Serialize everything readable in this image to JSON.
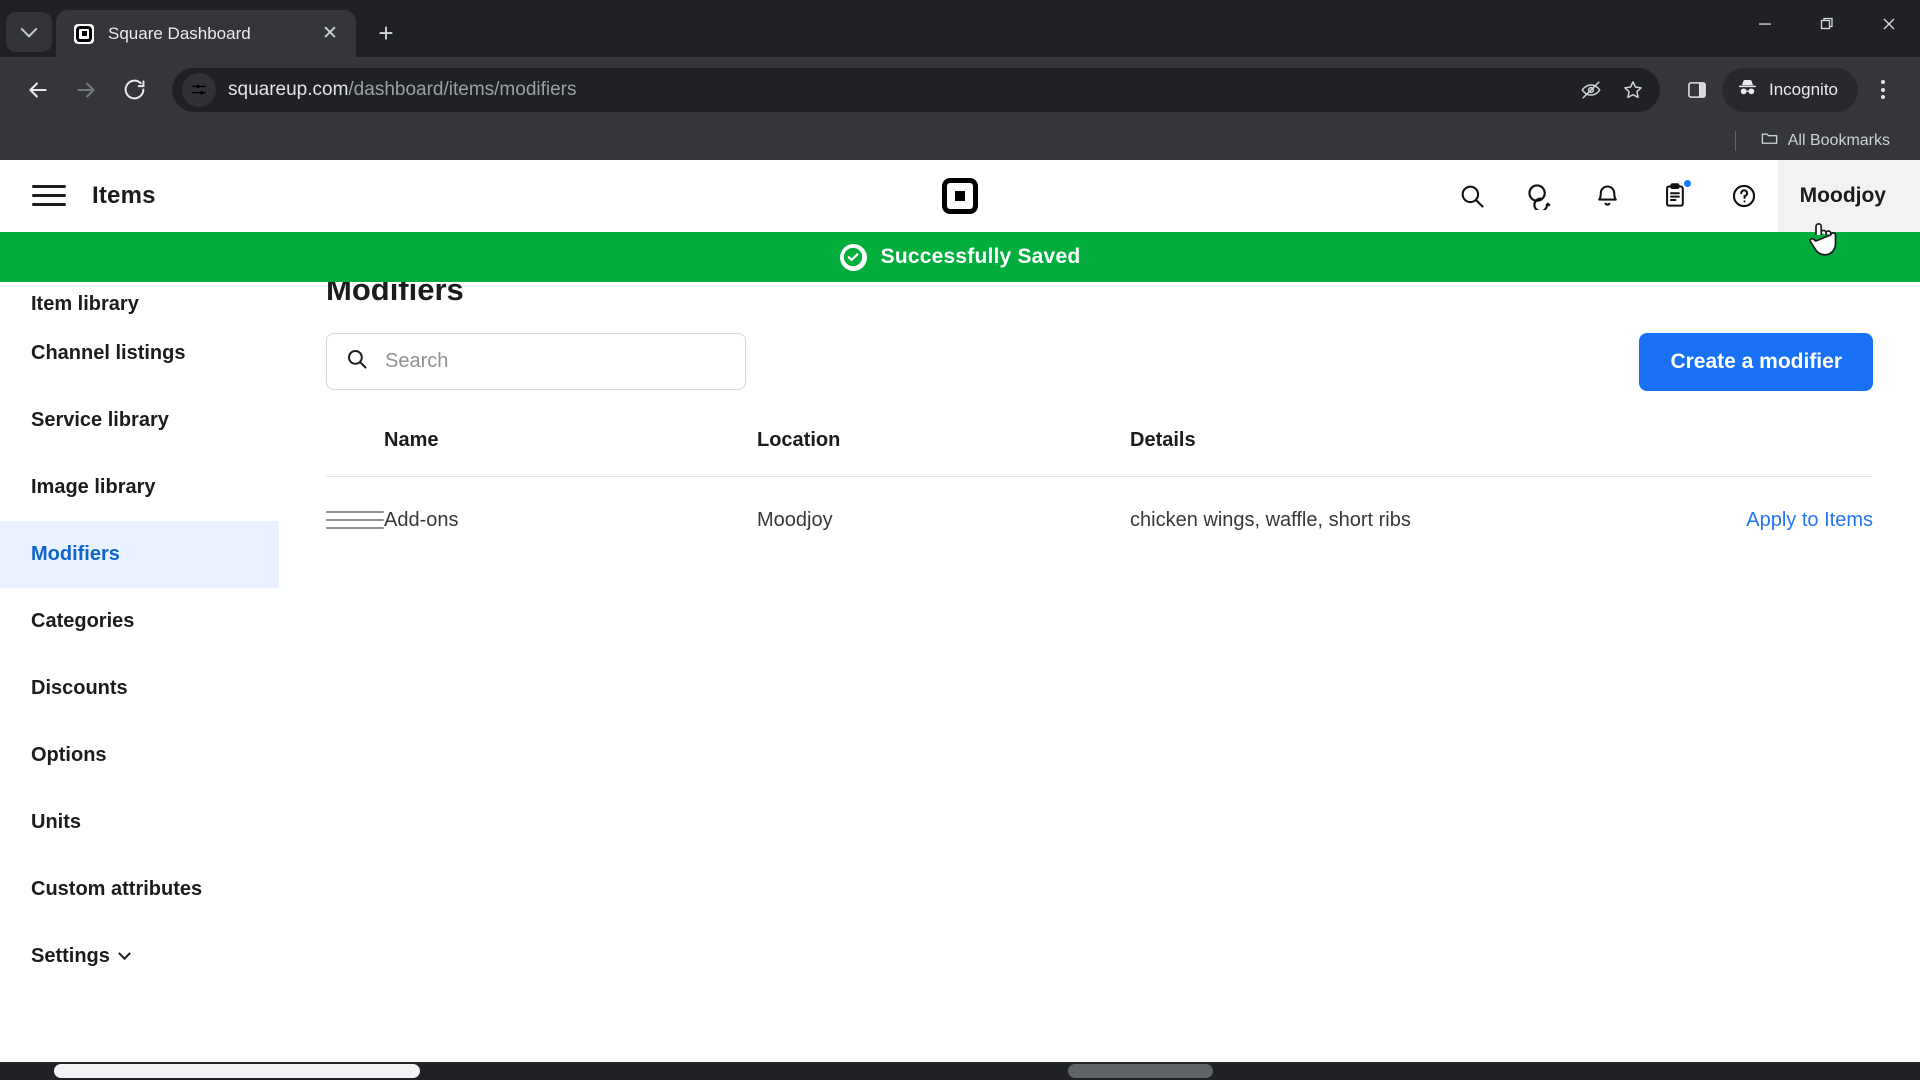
{
  "browser": {
    "tab": {
      "title": "Square Dashboard",
      "favicon_icon": "square-logo-icon",
      "close_icon": "close-icon"
    },
    "tab_search_icon": "chevron-down-icon",
    "new_tab_icon": "plus-icon",
    "window_controls": {
      "minimize_icon": "minimize-icon",
      "maximize_icon": "restore-icon",
      "close_icon": "close-icon"
    },
    "toolbar": {
      "back_icon": "back-arrow-icon",
      "forward_icon": "forward-arrow-icon",
      "reload_icon": "reload-icon",
      "site_info_icon": "page-settings-icon",
      "url_prefix": "squareup.com",
      "url_path": "/dashboard/items/modifiers",
      "url_full": "squareup.com/dashboard/items/modifiers",
      "tracking_protection_icon": "eye-slash-icon",
      "bookmark_icon": "star-icon",
      "side_panel_icon": "side-panel-icon",
      "incognito_label": "Incognito",
      "incognito_icon": "incognito-hat-icon",
      "menu_icon": "kebab-menu-icon"
    },
    "bookmarks_bar": {
      "all_bookmarks_label": "All Bookmarks",
      "folder_icon": "folder-icon"
    }
  },
  "app": {
    "header": {
      "menu_icon": "hamburger-menu-icon",
      "title": "Items",
      "logo_icon": "square-logo-icon",
      "icons": [
        {
          "name": "search-icon"
        },
        {
          "name": "messages-icon"
        },
        {
          "name": "notifications-bell-icon"
        },
        {
          "name": "clipboard-tasks-icon",
          "badge": true
        },
        {
          "name": "help-circle-icon"
        }
      ],
      "account_label": "Moodjoy"
    },
    "banner": {
      "text": "Successfully Saved",
      "icon": "check-circle-icon",
      "color": "#00ad3d"
    },
    "sidebar": {
      "items": [
        {
          "label": "Item library",
          "active": false
        },
        {
          "label": "Channel listings",
          "active": false
        },
        {
          "label": "Service library",
          "active": false
        },
        {
          "label": "Image library",
          "active": false
        },
        {
          "label": "Modifiers",
          "active": true
        },
        {
          "label": "Categories",
          "active": false
        },
        {
          "label": "Discounts",
          "active": false
        },
        {
          "label": "Options",
          "active": false
        },
        {
          "label": "Units",
          "active": false
        },
        {
          "label": "Custom attributes",
          "active": false
        },
        {
          "label": "Settings",
          "active": false,
          "expandable": true
        }
      ]
    },
    "main": {
      "page_title": "Modifiers",
      "search": {
        "placeholder": "Search",
        "value": "",
        "icon": "search-icon"
      },
      "create_button": "Create a modifier",
      "table": {
        "columns": [
          "Name",
          "Location",
          "Details"
        ],
        "rows": [
          {
            "handle_icon": "drag-handle-icon",
            "name": "Add-ons",
            "location": "Moodjoy",
            "details": "chicken wings, waffle, short ribs",
            "action": "Apply to Items"
          }
        ]
      }
    },
    "colors": {
      "accent_blue": "#1972f5",
      "link_blue": "#2575f0",
      "active_nav_blue": "#1164ce",
      "active_nav_bg": "#e9f2fe",
      "success_green": "#00ad3d"
    }
  }
}
